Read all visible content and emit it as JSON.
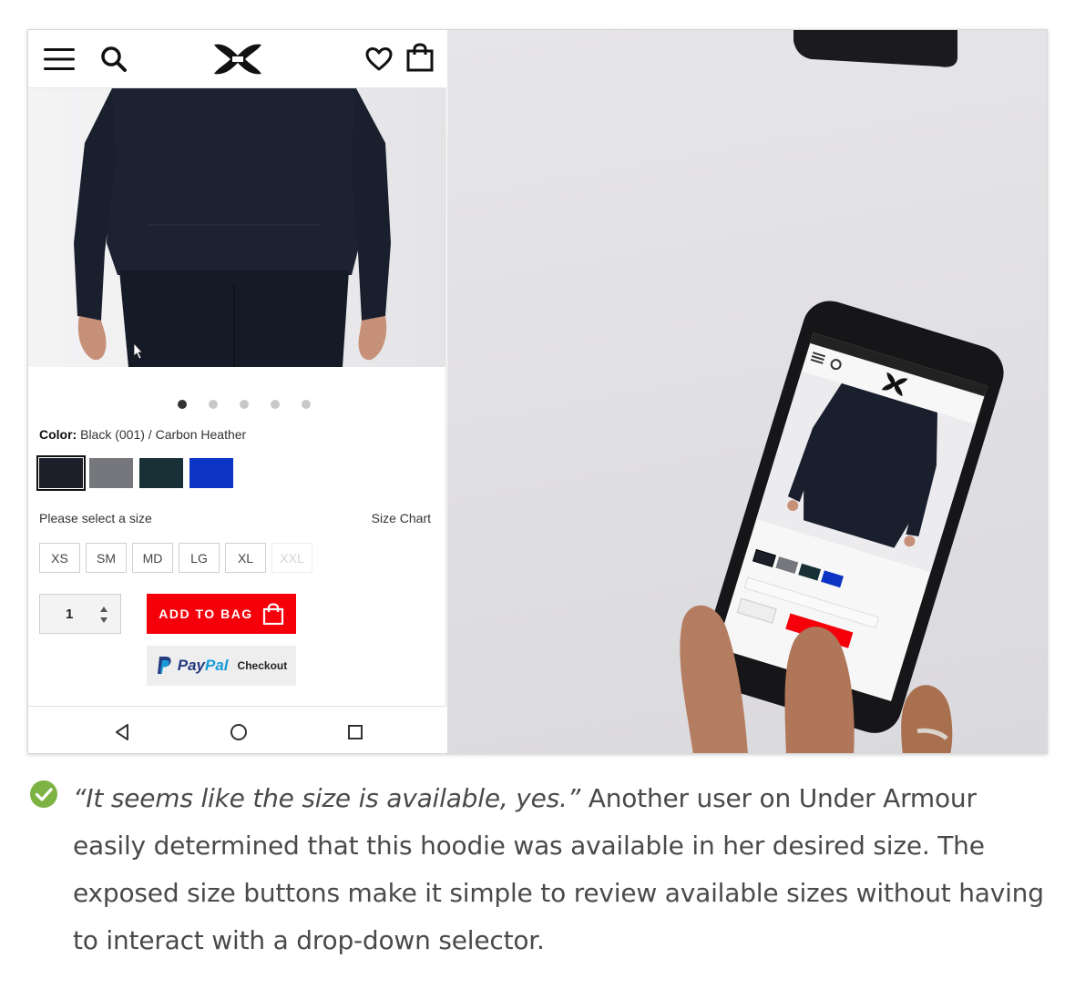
{
  "header": {
    "menu_icon": "hamburger-icon",
    "search_icon": "search-icon",
    "logo": "under-armour-logo",
    "wishlist_icon": "heart-icon",
    "bag_icon": "shopping-bag-icon"
  },
  "gallery": {
    "dots": 5,
    "active_dot": 0
  },
  "product": {
    "color_label": "Color:",
    "color_value": "Black (001) / Carbon Heather",
    "swatches": [
      {
        "color": "#1c1f2a",
        "selected": true
      },
      {
        "color": "#76777c",
        "selected": false
      },
      {
        "color": "#193136",
        "selected": false
      },
      {
        "color": "#0c34c4",
        "selected": false
      }
    ],
    "size_prompt": "Please select a size",
    "size_chart": "Size Chart",
    "sizes": [
      {
        "label": "XS",
        "available": true
      },
      {
        "label": "SM",
        "available": true
      },
      {
        "label": "MD",
        "available": true
      },
      {
        "label": "LG",
        "available": true
      },
      {
        "label": "XL",
        "available": true
      },
      {
        "label": "XXL",
        "available": false
      }
    ],
    "quantity": "1",
    "add_to_bag": "ADD TO BAG",
    "paypal": {
      "pay": "Pay",
      "pal": "Pal",
      "checkout": "Checkout"
    }
  },
  "system_nav": {
    "back_icon": "back-triangle-icon",
    "home_icon": "home-circle-icon",
    "recents_icon": "recents-square-icon"
  },
  "caption": {
    "quote": "“It seems like the size is available, yes.”",
    "text": " Another user on Under Armour easily determined that this hoodie was available in her desired size. The exposed size buttons make it simple to review available sizes without having to interact with a drop-down selector.",
    "status_icon": "check-circle-icon",
    "status_color": "#7cb342"
  },
  "colors": {
    "accent_red": "#f5000a"
  }
}
